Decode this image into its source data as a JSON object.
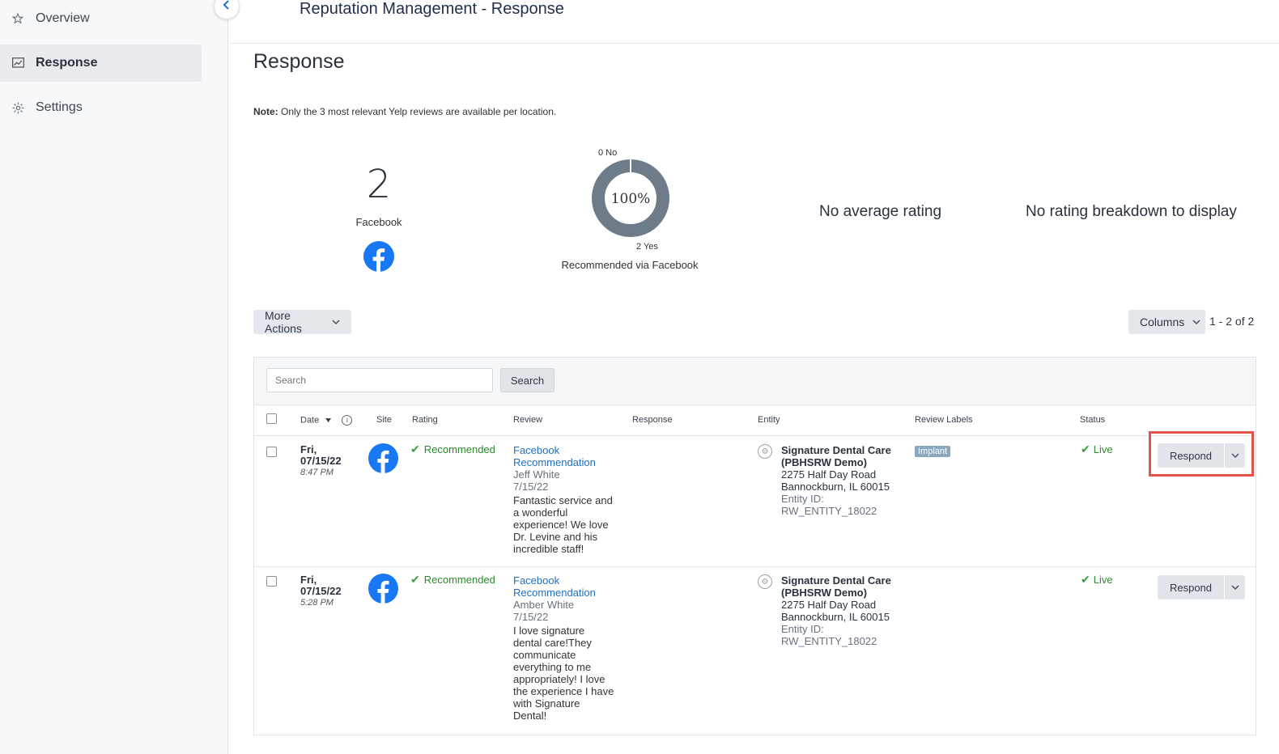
{
  "sidebar": {
    "items": [
      {
        "label": "Overview",
        "icon": "star-icon"
      },
      {
        "label": "Response",
        "icon": "chart-icon",
        "active": true
      },
      {
        "label": "Settings",
        "icon": "gear-icon"
      }
    ]
  },
  "header": {
    "title": "Reputation Management - Response"
  },
  "page": {
    "title": "Response",
    "note_label": "Note:",
    "note_text": " Only the 3 most relevant Yelp reviews are available per location."
  },
  "summary": {
    "count": "2",
    "site": "Facebook",
    "donut": {
      "percent": "100%",
      "no_label": "0 No",
      "yes_label": "2 Yes",
      "caption": "Recommended via Facebook",
      "yes_fraction": 1.0
    },
    "no_average": "No average rating",
    "no_breakdown": "No rating breakdown to display"
  },
  "toolbar": {
    "more_actions": "More Actions",
    "columns": "Columns",
    "pager": "1 - 2 of 2"
  },
  "search": {
    "placeholder": "Search",
    "button": "Search"
  },
  "table": {
    "headers": {
      "date": "Date",
      "site": "Site",
      "rating": "Rating",
      "review": "Review",
      "response": "Response",
      "entity": "Entity",
      "labels": "Review Labels",
      "status": "Status"
    },
    "rows": [
      {
        "day": "Fri,",
        "date": "07/15/22",
        "time": "8:47 PM",
        "rating": "Recommended",
        "review_title_1": "Facebook",
        "review_title_2": "Recommendation",
        "author": "Jeff White",
        "review_date": "7/15/22",
        "review_lines": [
          "Fantastic service and",
          "a wonderful",
          "experience! We love",
          "Dr. Levine and his",
          "incredible staff!"
        ],
        "entity_name_1": "Signature Dental Care",
        "entity_name_2": "(PBHSRW Demo)",
        "address_1": "2275 Half Day Road",
        "address_2": "Bannockburn, IL 60015",
        "entity_id_label": "Entity ID:",
        "entity_id": "RW_ENTITY_18022",
        "label": "Implant",
        "status": "Live",
        "action": "Respond"
      },
      {
        "day": "Fri,",
        "date": "07/15/22",
        "time": "5:28 PM",
        "rating": "Recommended",
        "review_title_1": "Facebook",
        "review_title_2": "Recommendation",
        "author": "Amber White",
        "review_date": "7/15/22",
        "review_lines": [
          "I love signature",
          "dental care!They",
          "communicate",
          "everything to me",
          "appropriately! I love",
          "the experience I have",
          "with Signature",
          "Dental!"
        ],
        "entity_name_1": "Signature Dental Care",
        "entity_name_2": "(PBHSRW Demo)",
        "address_1": "2275 Half Day Road",
        "address_2": "Bannockburn, IL 60015",
        "entity_id_label": "Entity ID:",
        "entity_id": "RW_ENTITY_18022",
        "label": "",
        "status": "Live",
        "action": "Respond"
      }
    ]
  },
  "colors": {
    "accent": "#1f6fc1",
    "facebook": "#1877f2",
    "success": "#2c8a2c",
    "highlight": "#e0524a",
    "donut": "#6e7c8a"
  }
}
